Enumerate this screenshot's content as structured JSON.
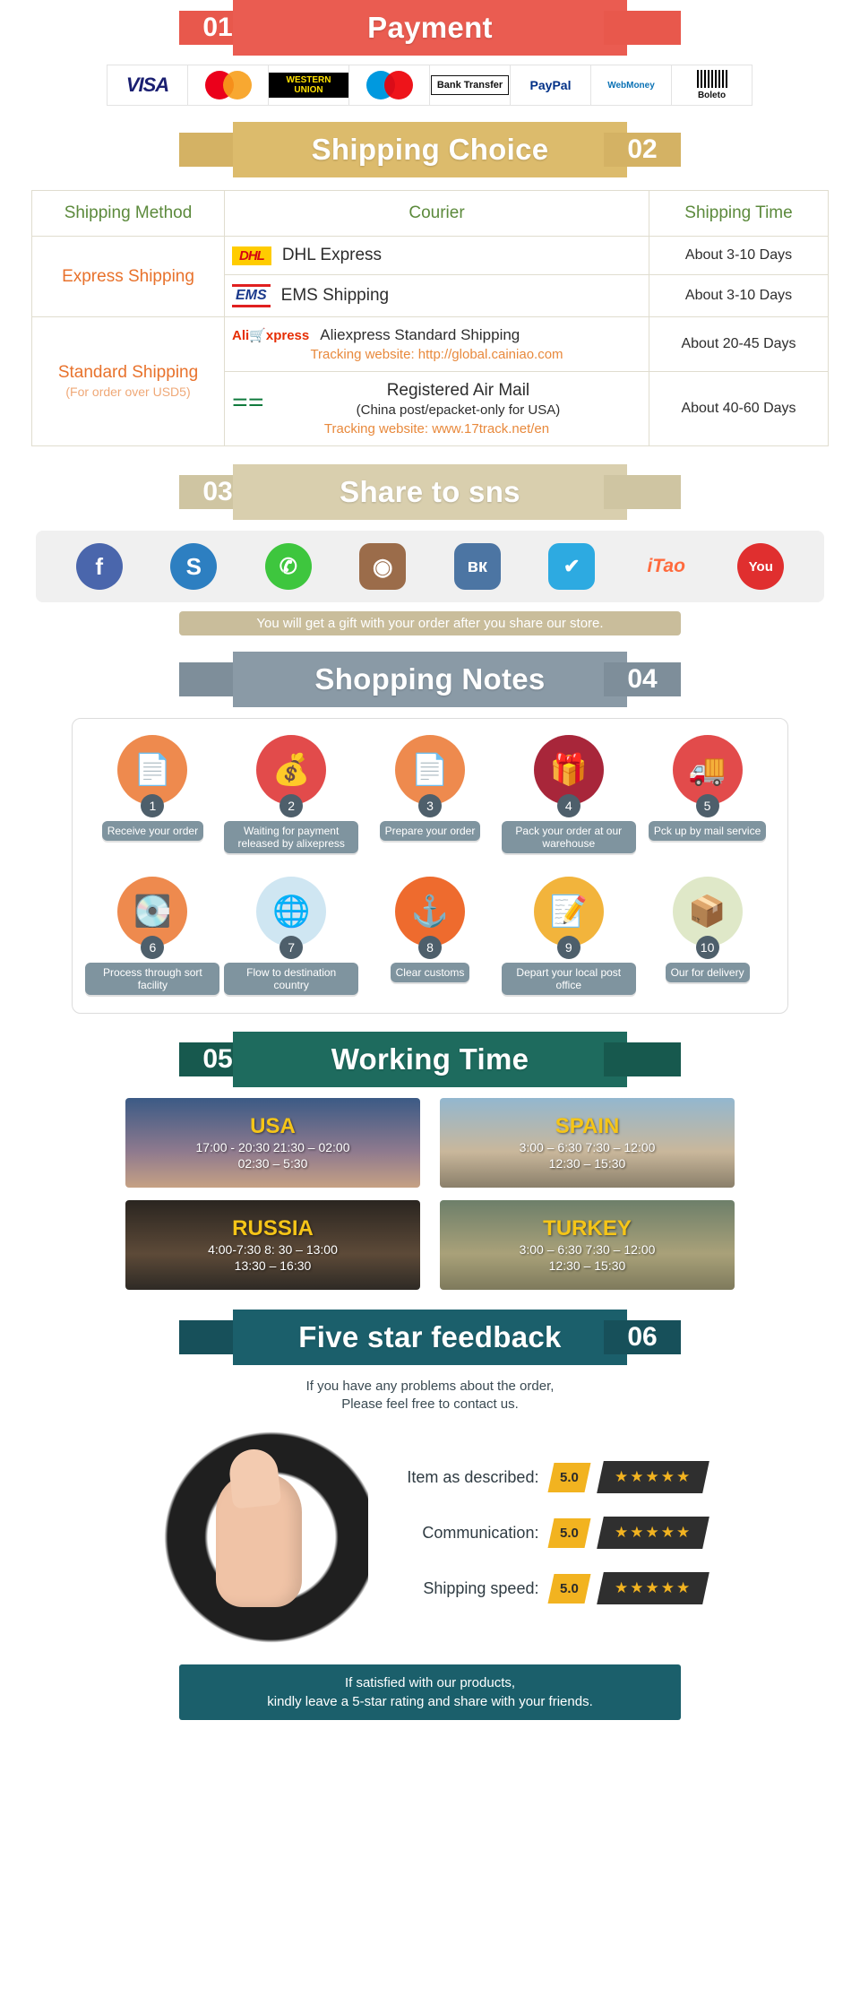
{
  "sections": {
    "payment": {
      "number": "01",
      "title": "Payment"
    },
    "shipping": {
      "number": "02",
      "title": "Shipping Choice"
    },
    "share": {
      "number": "03",
      "title": "Share to sns"
    },
    "notes": {
      "number": "04",
      "title": "Shopping Notes"
    },
    "working": {
      "number": "05",
      "title": "Working Time"
    },
    "feedback": {
      "number": "06",
      "title": "Five star feedback"
    }
  },
  "payment_methods": [
    {
      "name": "visa-logo",
      "label": "VISA"
    },
    {
      "name": "mastercard-logo",
      "label": "MasterCard"
    },
    {
      "name": "western-union-logo",
      "label": "WESTERN UNION"
    },
    {
      "name": "maestro-logo",
      "label": "Maestro"
    },
    {
      "name": "bank-transfer-logo",
      "label": "Bank Transfer"
    },
    {
      "name": "paypal-logo",
      "label": "PayPal"
    },
    {
      "name": "webmoney-logo",
      "label": "WebMoney"
    },
    {
      "name": "boleto-logo",
      "label": "Boleto"
    }
  ],
  "shipping_table": {
    "headers": [
      "Shipping Method",
      "Courier",
      "Shipping Time"
    ],
    "rows": [
      {
        "method": "Express Shipping",
        "method_sub": "",
        "courier_logo": "dhl-logo",
        "courier_logo_text": "DHL",
        "courier": "DHL Express",
        "tracking": "",
        "time": "About 3-10 Days"
      },
      {
        "method": "",
        "method_sub": "",
        "courier_logo": "ems-logo",
        "courier_logo_text": "EMS",
        "courier": "EMS Shipping",
        "tracking": "",
        "time": "About 3-10 Days"
      },
      {
        "method": "Standard Shipping",
        "method_sub": "(For order over USD5)",
        "courier_logo": "aliexpress-logo",
        "courier_logo_text": "Alixpress",
        "courier": "Aliexpress Standard Shipping",
        "tracking": "Tracking website: http://global.cainiao.com",
        "time": "About 20-45 Days"
      },
      {
        "method": "",
        "method_sub": "",
        "courier_logo": "china-post-logo",
        "courier_logo_text": "EE",
        "courier": "Registered Air Mail",
        "courier_sub": "(China post/epacket-only for USA)",
        "tracking": "Tracking website: www.17track.net/en",
        "time": "About 40-60 Days"
      }
    ]
  },
  "social": [
    {
      "name": "facebook-icon",
      "glyph": "f",
      "color": "#4a66ac",
      "shape": "circle"
    },
    {
      "name": "skype-icon",
      "glyph": "S",
      "color": "#2d7fc1",
      "shape": "circle"
    },
    {
      "name": "whatsapp-icon",
      "glyph": "✆",
      "color": "#3ec63e",
      "shape": "circle"
    },
    {
      "name": "instagram-icon",
      "glyph": "◉",
      "color": "#9b6c4a",
      "shape": "square"
    },
    {
      "name": "vk-icon",
      "glyph": "вк",
      "color": "#4c75a3",
      "shape": "square"
    },
    {
      "name": "twitter-icon",
      "glyph": "✔",
      "color": "#2daae1",
      "shape": "square"
    },
    {
      "name": "itao-icon",
      "glyph": "iTao",
      "color": "#ff6a3d",
      "shape": "plain"
    },
    {
      "name": "youtube-icon",
      "glyph": "You",
      "color": "#e02f2f",
      "shape": "circle"
    }
  ],
  "share_note": "You will get a gift with your order after you share our store.",
  "shopping_notes": [
    {
      "num": "1",
      "label": "Receive\nyour order",
      "icon": "document-icon",
      "color": "#ee8a4e"
    },
    {
      "num": "2",
      "label": "Waiting for payment\nreleased by alixepress",
      "icon": "money-bag-icon",
      "color": "#e24b4b"
    },
    {
      "num": "3",
      "label": "Prepare\nyour order",
      "icon": "document-icon",
      "color": "#ee8a4e"
    },
    {
      "num": "4",
      "label": "Pack your order\nat our warehouse",
      "icon": "gift-box-icon",
      "color": "#a8263a"
    },
    {
      "num": "5",
      "label": "Pck up by\nmail service",
      "icon": "mail-truck-icon",
      "color": "#e24b4b"
    },
    {
      "num": "6",
      "label": "Process through\nsort facility",
      "icon": "scanner-icon",
      "color": "#ee8a4e"
    },
    {
      "num": "7",
      "label": "Flow to destination\ncountry",
      "icon": "globe-icon",
      "color": "#cfe6f2"
    },
    {
      "num": "8",
      "label": "Clear\ncustoms",
      "icon": "anchor-icon",
      "color": "#ee6b2e"
    },
    {
      "num": "9",
      "label": "Depart your\nlocal post office",
      "icon": "postman-icon",
      "color": "#f2b43c"
    },
    {
      "num": "10",
      "label": "Our for\ndelivery",
      "icon": "parcel-icon",
      "color": "#dfe8c8"
    }
  ],
  "working_time": [
    {
      "country": "USA",
      "times": "17:00  -  20:30   21:30  –  02:00\n02:30  –  5:30"
    },
    {
      "country": "SPAIN",
      "times": "3:00  –   6:30    7:30  –   12:00\n12:30  –  15:30"
    },
    {
      "country": "RUSSIA",
      "times": "4:00-7:30    8: 30  –  13:00\n13:30  –  16:30"
    },
    {
      "country": "TURKEY",
      "times": "3:00  –   6:30    7:30  –   12:00\n12:30  –  15:30"
    }
  ],
  "feedback": {
    "intro_line1": "If you have any problems about the order,",
    "intro_line2": "Please feel free to contact us.",
    "ratings": [
      {
        "label": "Item as described:",
        "score": "5.0",
        "stars": "★★★★★"
      },
      {
        "label": "Communication:",
        "score": "5.0",
        "stars": "★★★★★"
      },
      {
        "label": "Shipping speed:",
        "score": "5.0",
        "stars": "★★★★★"
      }
    ],
    "footer_line1": "If satisfied with our products,",
    "footer_line2": "kindly leave a 5-star rating and share with your friends."
  }
}
